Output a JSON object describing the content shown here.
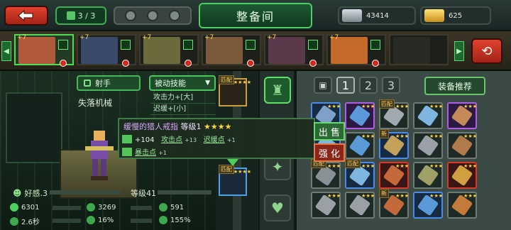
{
  "topbar": {
    "roster_count": "3 / 3",
    "title": "整备间",
    "silver_amount": "43414",
    "gold_amount": "625"
  },
  "heroes": [
    {
      "rank": "+7",
      "selected": true,
      "color": "#b25a3c"
    },
    {
      "rank": "+7",
      "selected": false,
      "color": "#3a4a6a"
    },
    {
      "rank": "+7",
      "selected": false,
      "color": "#6a6a3a"
    },
    {
      "rank": "+7",
      "selected": false,
      "color": "#7a5a3a"
    },
    {
      "rank": "+7",
      "selected": false,
      "color": "#5a3a4a"
    },
    {
      "rank": "+7",
      "selected": false,
      "color": "#c46a2a"
    },
    {
      "rank": "",
      "selected": false,
      "color": "#2a2a24"
    }
  ],
  "hero": {
    "class_label": "射手",
    "name": "失落机械",
    "favor_label": "好感.3",
    "level_label": "等级41",
    "stats": {
      "hp": "6301",
      "attack": "3269",
      "armor": "591",
      "interval": "2.6秒",
      "crit": "16%",
      "bonus": "155%"
    }
  },
  "skills": {
    "dropdown_label": "被动技能",
    "lines": [
      "攻击力+[大]",
      "迟缓+[小]"
    ]
  },
  "popup": {
    "item_name": "缓慢的猎人戒指",
    "level_text": "等级1",
    "stars": "★★★★",
    "line1_value": "+104",
    "line1_attr": "攻击点",
    "line1_small": "+13",
    "line1_attr2": "迟缓点",
    "line1_small2": "+1",
    "line2_attr": "暴击点",
    "line2_small": "+1"
  },
  "actions": {
    "sell_label": "出 售",
    "forge_label": "强 化"
  },
  "equipment_slots": [
    {
      "tag": "匹配",
      "stars": "★★★★"
    },
    {
      "tag": "",
      "stars": ""
    },
    {
      "tag": "",
      "stars": ""
    },
    {
      "tag": "匹配",
      "stars": "★★★★"
    }
  ],
  "inventory": {
    "tabs": [
      "1",
      "2",
      "3"
    ],
    "recommend_label": "装备推荐",
    "items": [
      {
        "q": "blue",
        "lbl": "",
        "c": "#7fa0c8"
      },
      {
        "q": "purple",
        "lbl": "",
        "c": "#5a9ad8"
      },
      {
        "q": "",
        "lbl": "匹配",
        "c": "#a0a8b0"
      },
      {
        "q": "",
        "lbl": "",
        "c": "#7fb6e0"
      },
      {
        "q": "purple",
        "lbl": "",
        "c": "#c48a5a"
      },
      {
        "q": "blue",
        "lbl": "",
        "c": "#7fb6e0"
      },
      {
        "q": "",
        "lbl": "",
        "c": "#5a9ad8"
      },
      {
        "q": "blue",
        "lbl": "新",
        "c": "#c4a05a"
      },
      {
        "q": "",
        "lbl": "",
        "c": "#9aa0a6"
      },
      {
        "q": "",
        "lbl": "",
        "c": "#b07a4a"
      },
      {
        "q": "",
        "lbl": "匹配",
        "c": "#8a9098"
      },
      {
        "q": "blue",
        "lbl": "匹配",
        "c": "#7fb6e0"
      },
      {
        "q": "red",
        "lbl": "",
        "c": "#c46a3a"
      },
      {
        "q": "",
        "lbl": "",
        "c": "#a0a066"
      },
      {
        "q": "red",
        "lbl": "",
        "c": "#d0a040"
      },
      {
        "q": "",
        "lbl": "",
        "c": "#9aa0a6"
      },
      {
        "q": "",
        "lbl": "",
        "c": "#9aa0a6"
      },
      {
        "q": "",
        "lbl": "新",
        "c": "#c46a3a"
      },
      {
        "q": "blue",
        "lbl": "",
        "c": "#5a9ad8"
      },
      {
        "q": "",
        "lbl": "",
        "c": "#c47a3a"
      }
    ]
  }
}
